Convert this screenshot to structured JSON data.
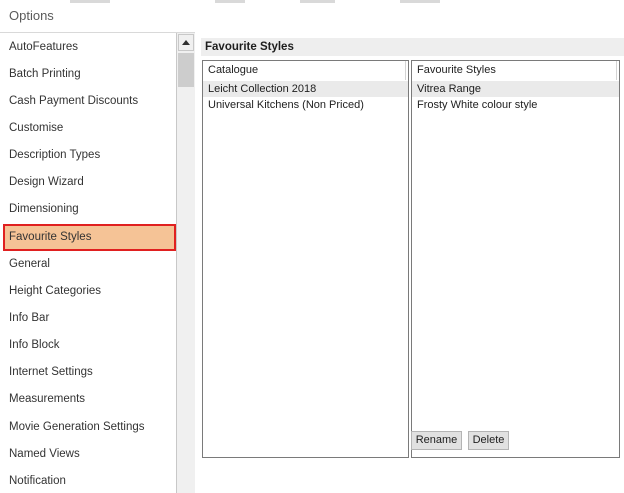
{
  "window": {
    "title": "Options"
  },
  "sidebar": {
    "items": [
      {
        "label": "AutoFeatures"
      },
      {
        "label": "Batch Printing"
      },
      {
        "label": "Cash Payment Discounts"
      },
      {
        "label": "Customise"
      },
      {
        "label": "Description Types"
      },
      {
        "label": "Design Wizard"
      },
      {
        "label": "Dimensioning"
      },
      {
        "label": "Favourite Styles",
        "selected": true
      },
      {
        "label": "General"
      },
      {
        "label": "Height Categories"
      },
      {
        "label": "Info Bar"
      },
      {
        "label": "Info Block"
      },
      {
        "label": "Internet Settings"
      },
      {
        "label": "Measurements"
      },
      {
        "label": "Movie Generation Settings"
      },
      {
        "label": "Named Views"
      },
      {
        "label": "Notification"
      }
    ]
  },
  "panel": {
    "title": "Favourite Styles",
    "catalogue": {
      "header": "Catalogue",
      "rows": [
        "Leicht Collection 2018",
        "Universal Kitchens (Non Priced)"
      ],
      "selected_index": 0
    },
    "styles": {
      "header": "Favourite Styles",
      "rows": [
        "Vitrea Range",
        "Frosty White colour style"
      ],
      "selected_index": 0
    },
    "buttons": {
      "rename": "Rename",
      "delete": "Delete"
    }
  },
  "colors": {
    "selected_item_bg": "#f5c396",
    "highlight_border": "#e02020",
    "selected_row_bg": "#eaeaea"
  }
}
